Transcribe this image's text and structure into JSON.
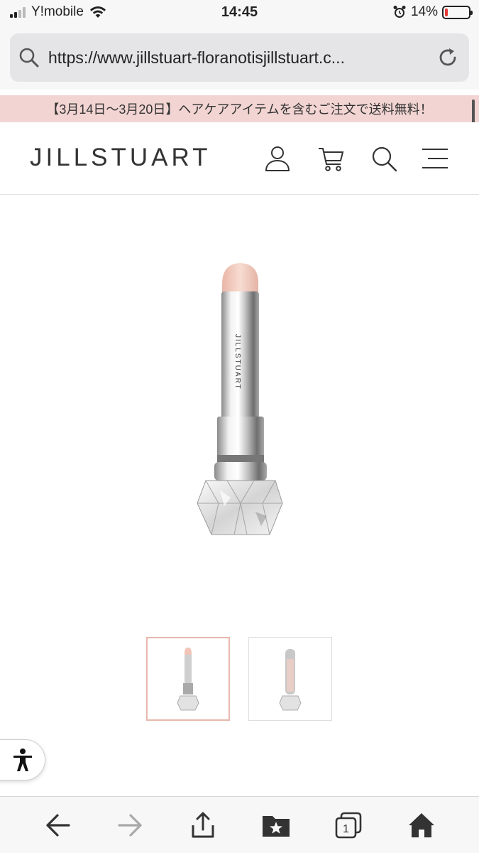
{
  "status_bar": {
    "carrier": "Y!mobile",
    "time": "14:45",
    "battery_percent": "14%",
    "battery_level": 0.14,
    "icons": [
      "signal-icon",
      "wifi-icon",
      "alarm-icon",
      "battery-icon"
    ]
  },
  "browser": {
    "url": "https://www.jillstuart-floranotisjillstuart.c..."
  },
  "promo_banner": {
    "text": "【3月14日～3月20日】ヘアケアアイテムを含むご注文で送料無料！",
    "color": "#f2d5d3"
  },
  "header": {
    "logo_text": "JILLSTUART",
    "icons": [
      "account-icon",
      "cart-icon",
      "search-icon",
      "menu-icon"
    ]
  },
  "product": {
    "brand_engraving": "JILLSTUART",
    "thumbnails": [
      {
        "name": "thumbnail-1",
        "selected": true
      },
      {
        "name": "thumbnail-2",
        "selected": false
      }
    ]
  },
  "toolbar": {
    "tabs_count": "1",
    "icons": [
      "back-icon",
      "forward-icon",
      "share-icon",
      "bookmarks-icon",
      "tabs-icon",
      "home-icon"
    ]
  },
  "colors": {
    "accent_pink": "#e8b8ad",
    "battery_low": "#e53935"
  }
}
